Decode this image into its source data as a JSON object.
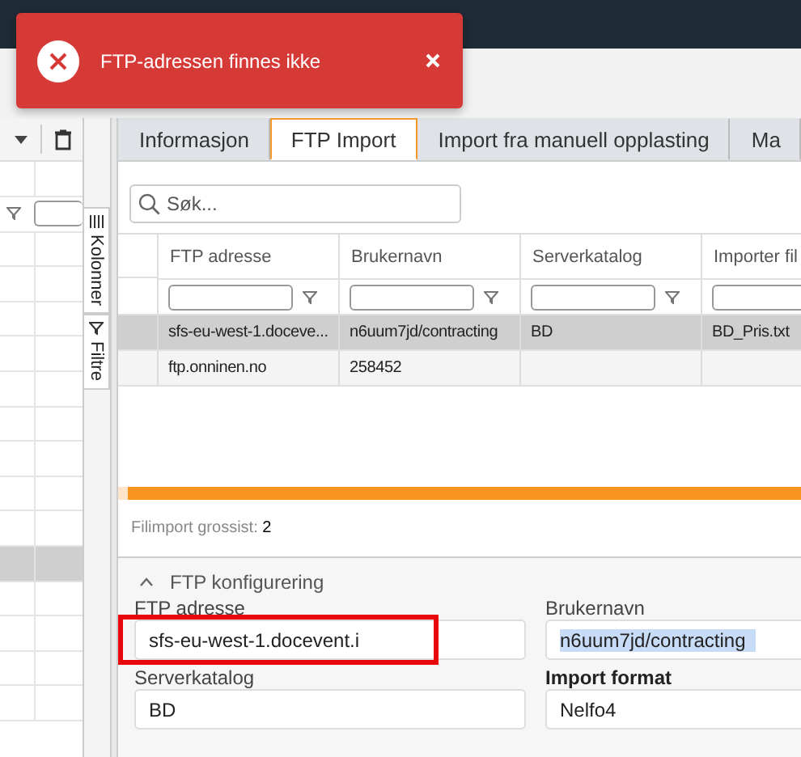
{
  "toast": {
    "message": "FTP-adressen finnes ikke"
  },
  "left_panel": {
    "side_tabs": [
      {
        "label": "Kolonner"
      },
      {
        "label": "Filtre"
      }
    ],
    "rows": [
      {
        "selected": false
      },
      {
        "selected": false
      },
      {
        "selected": false
      },
      {
        "selected": false
      },
      {
        "selected": false
      },
      {
        "selected": false
      },
      {
        "selected": false
      },
      {
        "selected": false
      },
      {
        "selected": false
      },
      {
        "selected": true
      },
      {
        "selected": false
      },
      {
        "selected": false
      },
      {
        "selected": false
      },
      {
        "selected": false
      }
    ]
  },
  "tabs": [
    {
      "label": "Informasjon",
      "selected": false
    },
    {
      "label": "FTP Import",
      "selected": true
    },
    {
      "label": "Import fra manuell opplasting",
      "selected": false
    },
    {
      "label": "Ma",
      "selected": false
    }
  ],
  "search": {
    "placeholder": "Søk..."
  },
  "table": {
    "columns": [
      "FTP adresse",
      "Brukernavn",
      "Serverkatalog",
      "Importer fil"
    ],
    "rows": [
      {
        "selected": true,
        "cells": [
          "sfs-eu-west-1.doceve...",
          "n6uum7jd/contracting",
          "BD",
          "BD_Pris.txt"
        ]
      },
      {
        "selected": false,
        "cells": [
          "ftp.onninen.no",
          "258452",
          null,
          null
        ]
      }
    ]
  },
  "footer": {
    "label": "Filimport grossist:",
    "count": "2"
  },
  "section": {
    "title": "FTP konfigurering",
    "expanded": true
  },
  "form": [
    {
      "label": "FTP adresse",
      "value": "sfs-eu-west-1.docevent.i",
      "highlighted": true,
      "value_selected": false,
      "bold_label": false
    },
    {
      "label": "Brukernavn",
      "value": "n6uum7jd/contracting",
      "highlighted": false,
      "value_selected": true,
      "bold_label": false
    },
    {
      "label": "Serverkatalog",
      "value": "BD",
      "highlighted": false,
      "value_selected": false,
      "bold_label": false
    },
    {
      "label": "Import format",
      "value": "Nelfo4",
      "highlighted": false,
      "value_selected": false,
      "bold_label": true
    }
  ]
}
